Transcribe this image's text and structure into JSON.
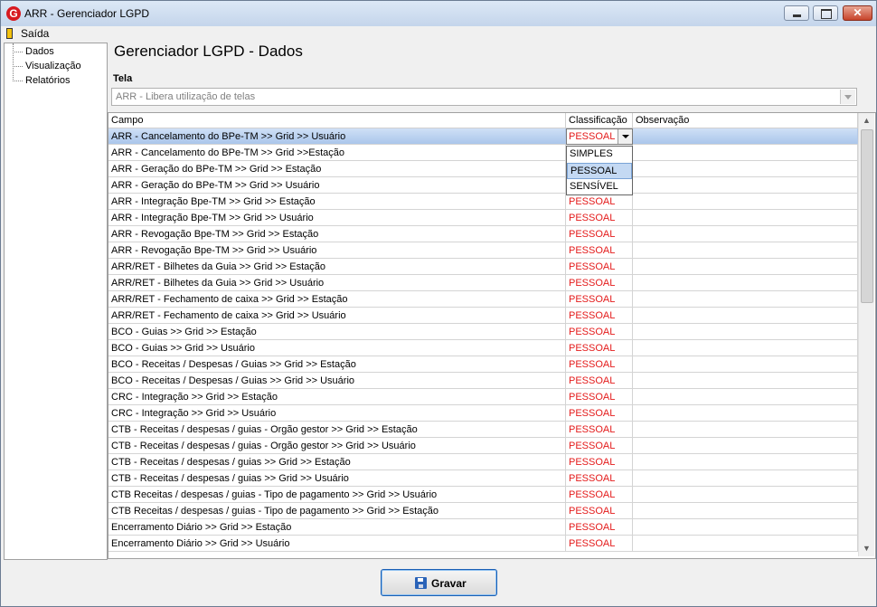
{
  "window": {
    "title": "ARR - Gerenciador LGPD",
    "app_icon_letter": "G"
  },
  "controls": {
    "min": "minimize-icon",
    "max": "maximize-icon",
    "close": "✕"
  },
  "menu": {
    "exit_label": "Saída"
  },
  "nav": {
    "items": [
      "Dados",
      "Visualização",
      "Relatórios"
    ]
  },
  "main": {
    "heading": "Gerenciador LGPD - Dados"
  },
  "tela": {
    "label": "Tela",
    "value": "ARR - Libera utilização de telas"
  },
  "grid": {
    "columns": [
      "Campo",
      "Classificação",
      "Observação"
    ],
    "rows": [
      {
        "campo": "ARR - Cancelamento do BPe-TM >> Grid >> Usuário",
        "classificacao": "PESSOAL",
        "observacao": ""
      },
      {
        "campo": "ARR - Cancelamento do BPe-TM >> Grid >>Estação",
        "classificacao": "",
        "observacao": ""
      },
      {
        "campo": "ARR - Geração do BPe-TM >> Grid >> Estação",
        "classificacao": "",
        "observacao": ""
      },
      {
        "campo": "ARR - Geração do BPe-TM >> Grid >> Usuário",
        "classificacao": "",
        "observacao": ""
      },
      {
        "campo": "ARR - Integração Bpe-TM >> Grid >> Estação",
        "classificacao": "PESSOAL",
        "observacao": ""
      },
      {
        "campo": "ARR - Integração Bpe-TM >> Grid >> Usuário",
        "classificacao": "PESSOAL",
        "observacao": ""
      },
      {
        "campo": "ARR - Revogação Bpe-TM >> Grid >> Estação",
        "classificacao": "PESSOAL",
        "observacao": ""
      },
      {
        "campo": "ARR - Revogação Bpe-TM >> Grid >> Usuário",
        "classificacao": "PESSOAL",
        "observacao": ""
      },
      {
        "campo": "ARR/RET - Bilhetes da Guia >> Grid >> Estação",
        "classificacao": "PESSOAL",
        "observacao": ""
      },
      {
        "campo": "ARR/RET - Bilhetes da Guia >> Grid >> Usuário",
        "classificacao": "PESSOAL",
        "observacao": ""
      },
      {
        "campo": "ARR/RET - Fechamento de caixa >> Grid >> Estação",
        "classificacao": "PESSOAL",
        "observacao": ""
      },
      {
        "campo": "ARR/RET - Fechamento de caixa >> Grid >> Usuário",
        "classificacao": "PESSOAL",
        "observacao": ""
      },
      {
        "campo": "BCO - Guias >> Grid >> Estação",
        "classificacao": "PESSOAL",
        "observacao": ""
      },
      {
        "campo": "BCO - Guias >> Grid >> Usuário",
        "classificacao": "PESSOAL",
        "observacao": ""
      },
      {
        "campo": "BCO - Receitas / Despesas / Guias >> Grid >> Estação",
        "classificacao": "PESSOAL",
        "observacao": ""
      },
      {
        "campo": "BCO - Receitas / Despesas / Guias >> Grid >> Usuário",
        "classificacao": "PESSOAL",
        "observacao": ""
      },
      {
        "campo": "CRC - Integração >> Grid >> Estação",
        "classificacao": "PESSOAL",
        "observacao": ""
      },
      {
        "campo": "CRC - Integração >> Grid >> Usuário",
        "classificacao": "PESSOAL",
        "observacao": ""
      },
      {
        "campo": "CTB - Receitas / despesas / guias - Orgão gestor >> Grid >> Estação",
        "classificacao": "PESSOAL",
        "observacao": ""
      },
      {
        "campo": "CTB - Receitas / despesas / guias - Orgão gestor >> Grid >> Usuário",
        "classificacao": "PESSOAL",
        "observacao": ""
      },
      {
        "campo": "CTB - Receitas / despesas / guias >> Grid >> Estação",
        "classificacao": "PESSOAL",
        "observacao": ""
      },
      {
        "campo": "CTB - Receitas / despesas / guias >> Grid >> Usuário",
        "classificacao": "PESSOAL",
        "observacao": ""
      },
      {
        "campo": "CTB Receitas / despesas / guias - Tipo de pagamento >> Grid >>  Usuário",
        "classificacao": "PESSOAL",
        "observacao": ""
      },
      {
        "campo": "CTB Receitas / despesas / guias - Tipo de pagamento >> Grid >> Estação",
        "classificacao": "PESSOAL",
        "observacao": ""
      },
      {
        "campo": "Encerramento Diário >> Grid >> Estação",
        "classificacao": "PESSOAL",
        "observacao": ""
      },
      {
        "campo": "Encerramento Diário >> Grid >> Usuário",
        "classificacao": "PESSOAL",
        "observacao": ""
      }
    ],
    "selected_row": 0,
    "editor_value": "PESSOAL",
    "dropdown_options": [
      "SIMPLES",
      "PESSOAL",
      "SENSÍVEL"
    ],
    "dropdown_highlighted": "PESSOAL"
  },
  "actions": {
    "save_label": "Gravar"
  },
  "colors": {
    "classification_text": "#e41b1b",
    "selected_row": "#b8cff0",
    "accent": "#1a5fb4"
  }
}
